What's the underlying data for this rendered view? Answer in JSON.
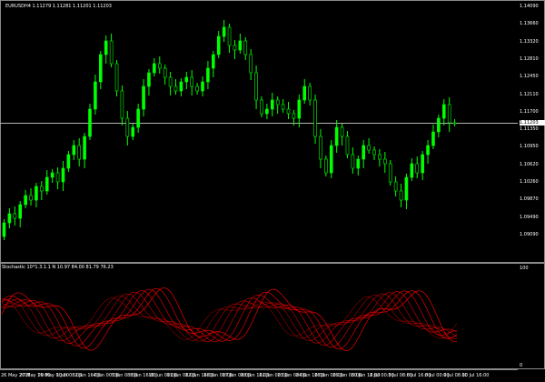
{
  "chart": {
    "symbol_header": "EURUSDH4 1.11279 1.11281 1.11201 1.11203",
    "oscillator_header": "Stochastic 10*1.3.1.1 N 10.97 84.00 81.79 76.23",
    "current_price": "1.11203",
    "colors": {
      "background": "#000000",
      "candle": "#00ff00",
      "oscillator": "#ff0000",
      "grid": "#8a8a8a"
    },
    "price_axis": [
      "1.14090",
      "1.13660",
      "1.13320",
      "1.12810",
      "1.12450",
      "1.12110",
      "1.11700",
      "1.11350",
      "1.10950",
      "1.10620",
      "1.10260",
      "1.09870",
      "1.09490",
      "1.09090"
    ],
    "oscillator_axis": [
      "100",
      "0"
    ],
    "time_axis": [
      "26 May 2015",
      "27 May 16:00",
      "29 May 00:00",
      "1 Jun 08:00",
      "2 Jun 16:00",
      "4 Jun 00:00",
      "5 Jun 08:00",
      "8 Jun 16:00",
      "10 Jun 00:00",
      "11 Jun 08:00",
      "12 Jun 16:00",
      "16 Jun 00:00",
      "17 Jun 08:00",
      "18 Jun 16:00",
      "22 Jun 00:00",
      "23 Jun 08:00",
      "24 Jun 16:00",
      "26 Jun 00:00",
      "29 Jun 08:00",
      "30 Jun 16:00",
      "2 Jul 00:00",
      "3 Jul 08:00",
      "6 Jul 16:00",
      "8 Jul 00:00",
      "9 Jul 08:00",
      "10 Jul 16:00"
    ]
  }
}
